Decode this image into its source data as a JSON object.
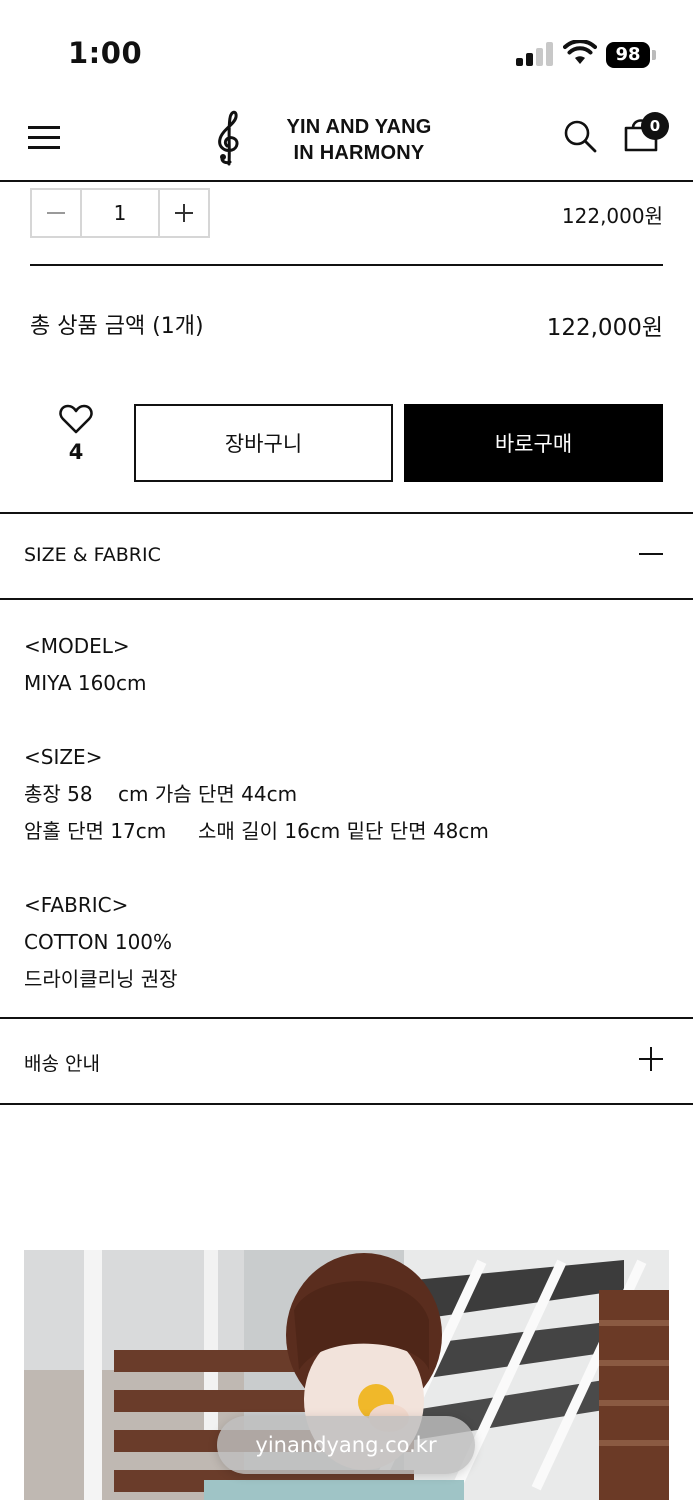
{
  "status_bar": {
    "time": "1:00",
    "battery": "98",
    "icons": [
      "signal-icon",
      "wifi-icon",
      "battery-icon"
    ]
  },
  "header": {
    "brand_line1": "YIN AND YANG",
    "brand_line2": "IN HARMONY",
    "cart_count": "0",
    "icons": [
      "menu-icon",
      "treble-clef-logo",
      "search-icon",
      "cart-icon"
    ]
  },
  "option": {
    "quantity": "1",
    "line_price": "122,000원"
  },
  "total": {
    "label": "총 상품 금액 (1개)",
    "price": "122,000원"
  },
  "actions": {
    "wish_count": "4",
    "cart_label": "장바구니",
    "buy_label": "바로구매"
  },
  "sections": [
    {
      "title": "SIZE & FABRIC",
      "expanded": true,
      "lines": {
        "model_heading": "<MODEL>",
        "model": "MIYA 160cm",
        "size_heading": "<SIZE>",
        "size_1": "총장 58    cm 가슴 단면 44cm",
        "size_2": "암홀 단면 17cm     소매 길이 16cm 밑단 단면 48cm",
        "fabric_heading": "<FABRIC>",
        "fabric": "COTTON 100%",
        "care": "드라이클리닝 권장"
      }
    },
    {
      "title": "배송 안내",
      "expanded": false
    }
  ],
  "browser": {
    "url": "yinandyang.co.kr"
  },
  "colors": {
    "primary": "#000000",
    "border": "#111111",
    "stepper_border": "#d6d6d6"
  }
}
